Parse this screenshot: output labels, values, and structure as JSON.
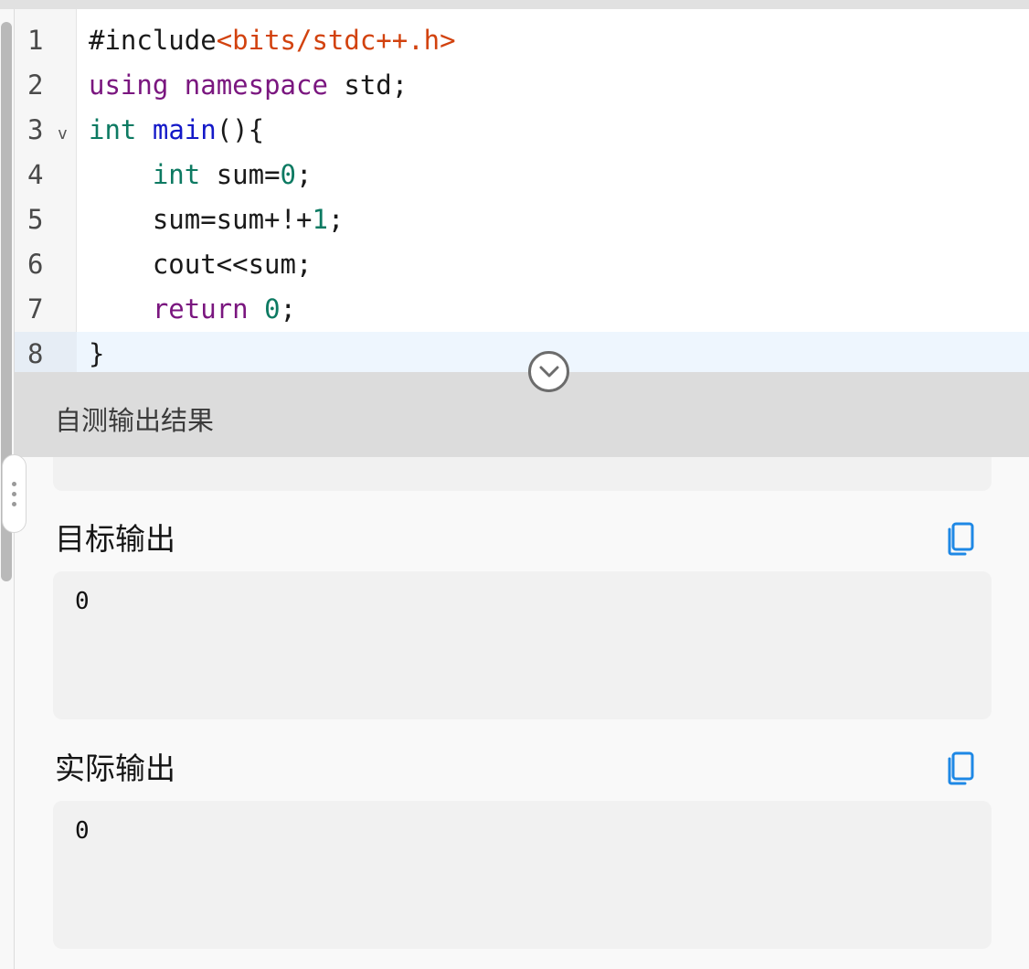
{
  "editor": {
    "lines": [
      {
        "num": "1",
        "tokens": [
          {
            "t": "#include",
            "c": "plain"
          },
          {
            "t": "<bits/stdc++.h>",
            "c": "str"
          }
        ]
      },
      {
        "num": "2",
        "tokens": [
          {
            "t": "using",
            "c": "kw"
          },
          {
            "t": " ",
            "c": "plain"
          },
          {
            "t": "namespace",
            "c": "kw"
          },
          {
            "t": " std;",
            "c": "plain"
          }
        ]
      },
      {
        "num": "3",
        "fold": "v",
        "tokens": [
          {
            "t": "int",
            "c": "ty"
          },
          {
            "t": " ",
            "c": "plain"
          },
          {
            "t": "main",
            "c": "fn"
          },
          {
            "t": "(){",
            "c": "plain"
          }
        ]
      },
      {
        "num": "4",
        "tokens": [
          {
            "t": "    ",
            "c": "plain"
          },
          {
            "t": "int",
            "c": "ty"
          },
          {
            "t": " sum=",
            "c": "plain"
          },
          {
            "t": "0",
            "c": "num"
          },
          {
            "t": ";",
            "c": "plain"
          }
        ]
      },
      {
        "num": "5",
        "tokens": [
          {
            "t": "    sum=sum+!+",
            "c": "plain"
          },
          {
            "t": "1",
            "c": "num"
          },
          {
            "t": ";",
            "c": "plain"
          }
        ]
      },
      {
        "num": "6",
        "tokens": [
          {
            "t": "    cout<<sum;",
            "c": "plain"
          }
        ]
      },
      {
        "num": "7",
        "tokens": [
          {
            "t": "    ",
            "c": "plain"
          },
          {
            "t": "return",
            "c": "kw"
          },
          {
            "t": " ",
            "c": "plain"
          },
          {
            "t": "0",
            "c": "num"
          },
          {
            "t": ";",
            "c": "plain"
          }
        ]
      },
      {
        "num": "8",
        "active": true,
        "tokens": [
          {
            "t": "}",
            "c": "plain"
          }
        ]
      }
    ]
  },
  "results": {
    "title": "自测输出结果",
    "expected": {
      "label": "目标输出",
      "value": "0"
    },
    "actual": {
      "label": "实际输出",
      "value": "0"
    }
  },
  "icons": {
    "toggle": "chevron-down-icon",
    "copy": "copy-icon",
    "handle": "drag-handle-icon"
  },
  "colors": {
    "keyword": "#7a167f",
    "type": "#0d7a62",
    "function": "#1419c8",
    "string": "#d2420e",
    "copy_icon": "#1e88e5"
  }
}
